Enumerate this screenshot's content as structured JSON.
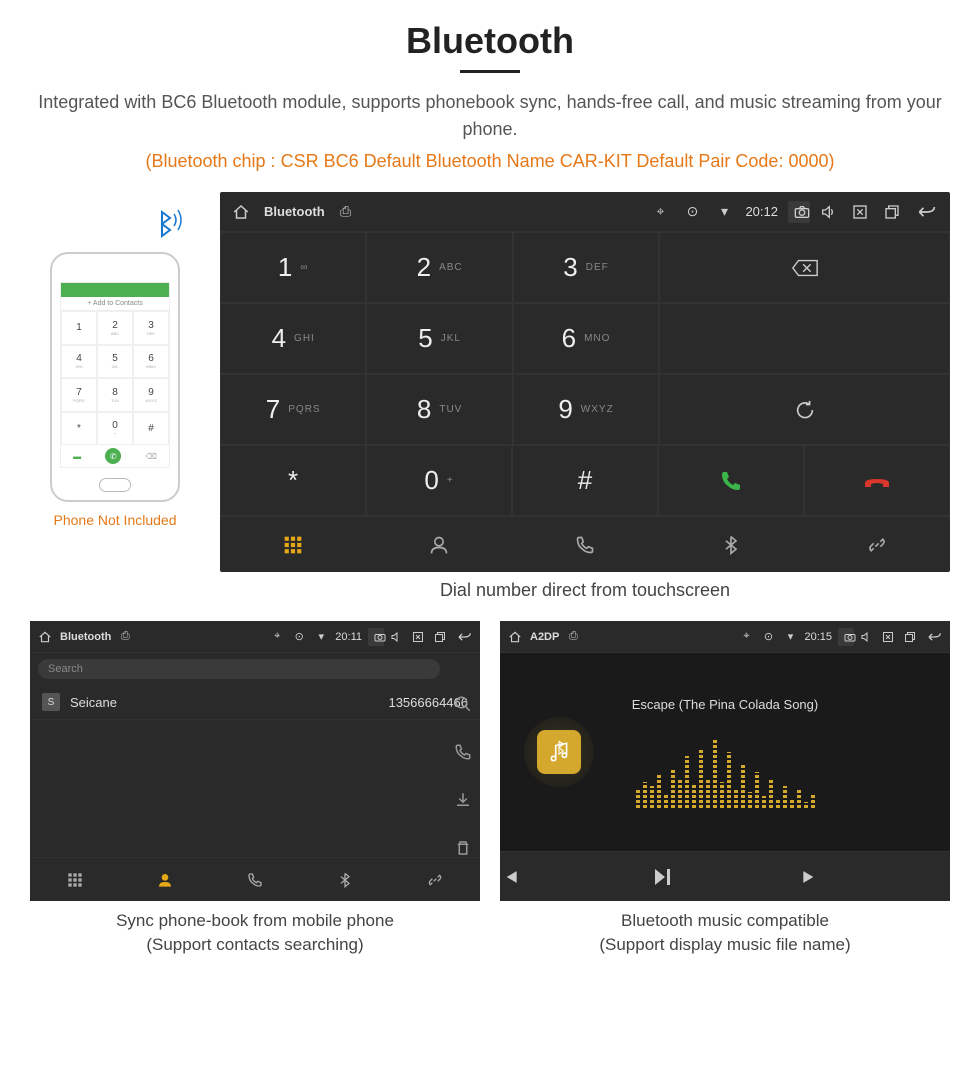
{
  "header": {
    "title": "Bluetooth",
    "subtitle": "Integrated with BC6 Bluetooth module, supports phonebook sync, hands-free call, and music streaming from your phone.",
    "specs": "(Bluetooth chip : CSR BC6    Default Bluetooth Name CAR-KIT    Default Pair Code: 0000)"
  },
  "phone_mock": {
    "add_contacts": "+  Add to Contacts",
    "caption": "Phone Not Included",
    "keys": [
      {
        "d": "1",
        "l": ""
      },
      {
        "d": "2",
        "l": "ABC"
      },
      {
        "d": "3",
        "l": "DEF"
      },
      {
        "d": "4",
        "l": "GHI"
      },
      {
        "d": "5",
        "l": "JKL"
      },
      {
        "d": "6",
        "l": "MNO"
      },
      {
        "d": "7",
        "l": "PQRS"
      },
      {
        "d": "8",
        "l": "TUV"
      },
      {
        "d": "9",
        "l": "WXYZ"
      },
      {
        "d": "*",
        "l": ""
      },
      {
        "d": "0",
        "l": "+"
      },
      {
        "d": "#",
        "l": ""
      }
    ]
  },
  "dialer": {
    "status": {
      "app": "Bluetooth",
      "time": "20:12"
    },
    "keys": [
      [
        {
          "d": "1",
          "l": "∞"
        },
        {
          "d": "2",
          "l": "ABC"
        },
        {
          "d": "3",
          "l": "DEF"
        }
      ],
      [
        {
          "d": "4",
          "l": "GHI"
        },
        {
          "d": "5",
          "l": "JKL"
        },
        {
          "d": "6",
          "l": "MNO"
        }
      ],
      [
        {
          "d": "7",
          "l": "PQRS"
        },
        {
          "d": "8",
          "l": "TUV"
        },
        {
          "d": "9",
          "l": "WXYZ"
        }
      ],
      [
        {
          "d": "*",
          "l": ""
        },
        {
          "d": "0",
          "l": "+"
        },
        {
          "d": "#",
          "l": ""
        }
      ]
    ],
    "caption": "Dial number direct from touchscreen"
  },
  "phonebook": {
    "status": {
      "app": "Bluetooth",
      "time": "20:11"
    },
    "search_placeholder": "Search",
    "contact": {
      "badge": "S",
      "name": "Seicane",
      "number": "13566664466"
    },
    "caption_line1": "Sync phone-book from mobile phone",
    "caption_line2": "(Support contacts searching)"
  },
  "music": {
    "status": {
      "app": "A2DP",
      "time": "20:15"
    },
    "track": "Escape (The Pina Colada Song)",
    "eq_heights": [
      18,
      26,
      22,
      34,
      14,
      40,
      28,
      52,
      24,
      60,
      30,
      70,
      26,
      56,
      20,
      44,
      16,
      36,
      12,
      28,
      10,
      22,
      8,
      18,
      6,
      14
    ],
    "caption_line1": "Bluetooth music compatible",
    "caption_line2": "(Support display music file name)"
  }
}
